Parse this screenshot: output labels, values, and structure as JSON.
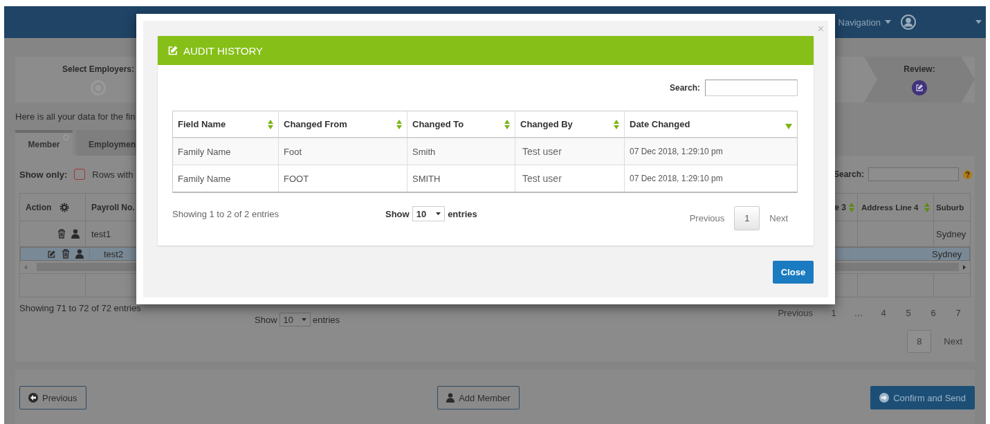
{
  "navbar": {
    "menu_label": "Navigation"
  },
  "wizard": [
    {
      "label": "Select Employers:",
      "kind": "done"
    },
    {
      "label": "Review:",
      "kind": "current"
    }
  ],
  "intro_text": "Here is all your data for the fin",
  "tabs": [
    {
      "label": "Member",
      "selected": true
    },
    {
      "label": "Employmen",
      "selected": false
    }
  ],
  "filter": {
    "label": "Show only:",
    "checked": false,
    "option": "Rows with"
  },
  "member_search": {
    "label": "Search:"
  },
  "member_table": {
    "columns": [
      {
        "label": "Action",
        "kind": "action"
      },
      {
        "label": "Payroll No.",
        "kind": "plain"
      },
      {
        "label": "e 3",
        "kind": "sortable"
      },
      {
        "label": "Address Line 4",
        "kind": "sortable"
      },
      {
        "label": "Suburb",
        "kind": "plain"
      }
    ],
    "rows": [
      {
        "payroll_no": "test1",
        "suburb": "Sydney",
        "editable": false,
        "selected": false
      },
      {
        "payroll_no": "test2",
        "suburb": "Sydney",
        "editable": true,
        "selected": true
      }
    ]
  },
  "member_footer": {
    "info": "Showing 71 to 72 of 72 entries",
    "show_label": "Show",
    "page_size": "10",
    "entries_label": "entries",
    "pagination": [
      {
        "label": "Previous",
        "kind": "nav",
        "selected": false
      },
      {
        "label": "1",
        "kind": "page",
        "selected": false
      },
      {
        "label": "…",
        "kind": "ellipsis",
        "selected": false
      },
      {
        "label": "4",
        "kind": "page",
        "selected": false
      },
      {
        "label": "5",
        "kind": "page",
        "selected": false
      },
      {
        "label": "6",
        "kind": "page",
        "selected": false
      },
      {
        "label": "7",
        "kind": "page",
        "selected": false
      },
      {
        "label": "8",
        "kind": "page",
        "selected": true
      },
      {
        "label": "Next",
        "kind": "nav",
        "selected": false
      }
    ]
  },
  "actions": [
    {
      "label": "Previous",
      "kind": "back"
    },
    {
      "label": "Add Member",
      "kind": "add"
    },
    {
      "label": "Confirm and Send",
      "kind": "confirm"
    }
  ],
  "modal": {
    "title": "AUDIT HISTORY",
    "close_symbol": "×",
    "search_label": "Search:",
    "columns": [
      {
        "label": "Field Name",
        "kind": "sortable"
      },
      {
        "label": "Changed From",
        "kind": "sortable"
      },
      {
        "label": "Changed To",
        "kind": "sortable"
      },
      {
        "label": "Changed By",
        "kind": "sortable"
      },
      {
        "label": "Date Changed",
        "kind": "sorted"
      }
    ],
    "rows": [
      [
        "Family Name",
        "Foot",
        "Smith",
        "Test user",
        "07 Dec 2018, 1:29:10 pm"
      ],
      [
        "Family Name",
        "FOOT",
        "SMITH",
        "Test user",
        "07 Dec 2018, 1:29:10 pm"
      ]
    ],
    "info": "Showing 1 to 2 of 2 entries",
    "show_label": "Show",
    "page_size": "10",
    "entries_label": "entries",
    "pagination": [
      {
        "label": "Previous",
        "kind": "nav",
        "selected": false
      },
      {
        "label": "1",
        "kind": "page",
        "selected": true
      },
      {
        "label": "Next",
        "kind": "nav",
        "selected": false
      }
    ],
    "close_button": "Close"
  }
}
